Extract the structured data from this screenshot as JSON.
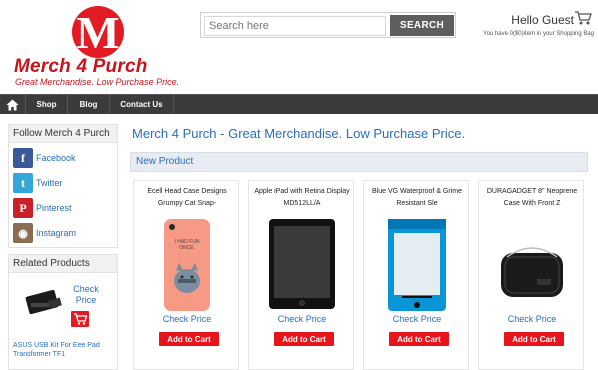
{
  "brand": {
    "logo_letter": "M",
    "name": "Merch 4 Purch",
    "tagline": "Great Merchandise. Low Purchase Price.",
    "color": "#e31b23"
  },
  "search": {
    "placeholder": "Search here",
    "button_label": "SEARCH"
  },
  "account": {
    "greeting": "Hello Guest",
    "bag_text": "You have 0($0)item in your Shopping Bag",
    "cart_icon": "shopping-cart-icon"
  },
  "nav": {
    "home_icon": "home-icon",
    "items": [
      {
        "label": "Shop"
      },
      {
        "label": "Blog"
      },
      {
        "label": "Contact Us"
      }
    ]
  },
  "sidebar": {
    "follow_title": "Follow Merch 4 Purch",
    "social": [
      {
        "label": "Facebook",
        "icon": "facebook-icon",
        "color": "#3b5998",
        "glyph": "f"
      },
      {
        "label": "Twitter",
        "icon": "twitter-icon",
        "color": "#33a7d9",
        "glyph": "t"
      },
      {
        "label": "Pinterest",
        "icon": "pinterest-icon",
        "color": "#cb2027",
        "glyph": "P"
      },
      {
        "label": "Instagram",
        "icon": "instagram-icon",
        "color": "#8a6d52",
        "glyph": "◉"
      }
    ],
    "related_title": "Related Products",
    "related": {
      "check_price": "Check Price",
      "name": "ASUS USB Kit For Eee Pad Transformer TF1"
    }
  },
  "main": {
    "title": "Merch 4 Purch - Great Merchandise. Low Purchase Price.",
    "section_label": "New Product",
    "products": [
      {
        "name": "Ecell Head Case Designs Grumpy Cat Snap-",
        "check_price": "Check Price",
        "add_label": "Add to Cart",
        "image": "pink-phone-case"
      },
      {
        "name": "Apple iPad with Retina Display MD512LL/A",
        "check_price": "Check Price",
        "add_label": "Add to Cart",
        "image": "ipad"
      },
      {
        "name": "Blue VG Waterproof & Grime Resistant Sle",
        "check_price": "Check Price",
        "add_label": "Add to Cart",
        "image": "waterproof-pouch"
      },
      {
        "name": "DURAGADGET 8\" Neoprene Case With Front Z",
        "check_price": "Check Price",
        "add_label": "Add to Cart",
        "image": "neoprene-case"
      }
    ]
  }
}
